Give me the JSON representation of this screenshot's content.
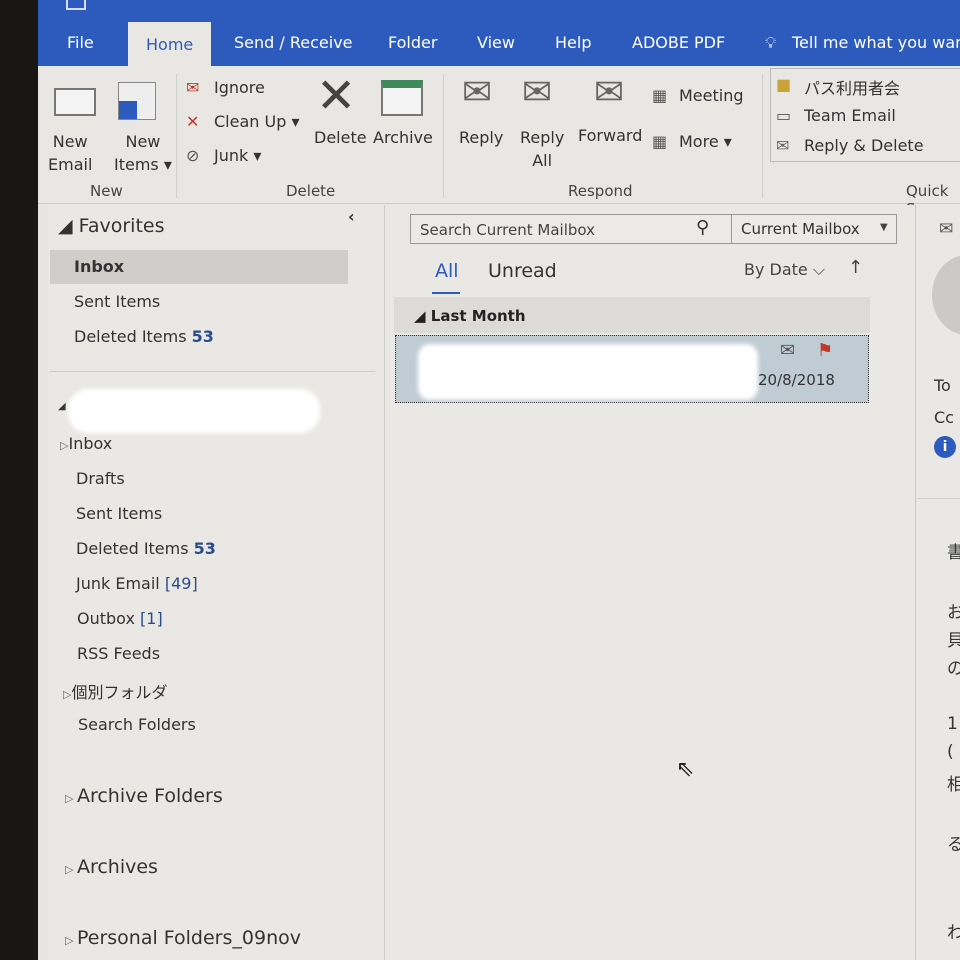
{
  "ribbon_tabs": [
    "File",
    "Home",
    "Send / Receive",
    "Folder",
    "View",
    "Help",
    "ADOBE PDF"
  ],
  "tell_me": "Tell me what you wan",
  "groups": {
    "new": "New",
    "delete": "Delete",
    "respond": "Respond",
    "quick_steps": "Quick S"
  },
  "buttons": {
    "new_email": [
      "New",
      "Email"
    ],
    "new_items": [
      "New",
      "Items ▾"
    ],
    "ignore": "Ignore",
    "clean_up": "Clean Up ▾",
    "junk": "Junk ▾",
    "delete": "Delete",
    "archive": "Archive",
    "reply": "Reply",
    "reply_all": [
      "Reply",
      "All"
    ],
    "forward": "Forward",
    "meeting": "Meeting",
    "more": "More ▾"
  },
  "quick_steps": [
    "パス利用者会",
    "Team Email",
    "Reply & Delete"
  ],
  "favorites": {
    "header": "Favorites",
    "items": [
      {
        "label": "Inbox",
        "count": ""
      },
      {
        "label": "Sent Items",
        "count": ""
      },
      {
        "label": "Deleted Items",
        "count": "53"
      }
    ]
  },
  "account_folders": [
    {
      "label": "Inbox",
      "count": ""
    },
    {
      "label": "Drafts",
      "count": ""
    },
    {
      "label": "Sent Items",
      "count": ""
    },
    {
      "label": "Deleted Items",
      "count": "53"
    },
    {
      "label": "Junk Email",
      "count": "[49]"
    },
    {
      "label": "Outbox",
      "count": "[1]"
    },
    {
      "label": "RSS Feeds",
      "count": ""
    },
    {
      "label": "個別フォルダ",
      "count": ""
    },
    {
      "label": "Search Folders",
      "count": ""
    }
  ],
  "stores": [
    "Archive Folders",
    "Archives",
    "Personal Folders_09nov"
  ],
  "search": {
    "placeholder": "Search Current Mailbox",
    "scope": "Current Mailbox"
  },
  "filters": {
    "all": "All",
    "unread": "Unread",
    "sort": "By Date",
    "sort_dir": "↑"
  },
  "group_header": "Last Month",
  "message": {
    "date": "20/8/2018",
    "flagged": true,
    "replied": true
  },
  "reading": {
    "to": "To",
    "cc": "Cc",
    "body_fragments": [
      "書",
      "お",
      "貝",
      "の",
      "1",
      "(",
      "相",
      "る",
      "わ"
    ]
  },
  "colors": {
    "accent": "#2d5bbd",
    "selected": "#c0ccd4",
    "flag": "#c0392b"
  }
}
